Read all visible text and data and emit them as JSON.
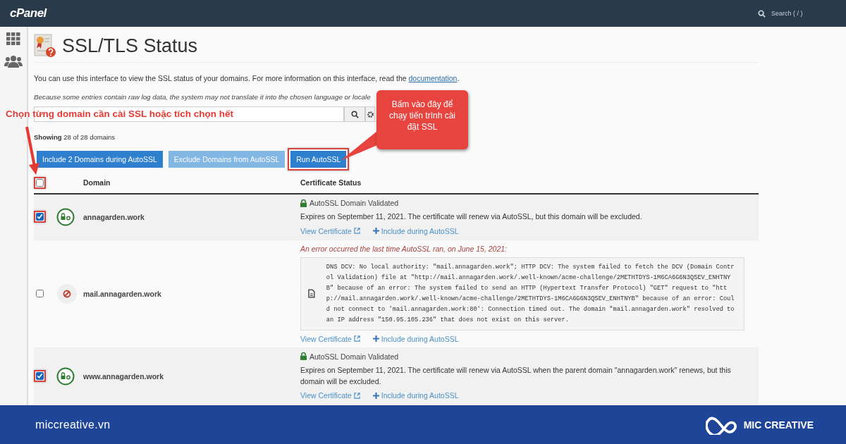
{
  "header": {
    "logo": "cPanel",
    "search_placeholder": "Search ( / )"
  },
  "page": {
    "title": "SSL/TLS Status",
    "description": "You can use this interface to view the SSL status of your domains. For more information on this interface, read the ",
    "description_link": "documentation",
    "description_end": ".",
    "notice": "Because some entries contain raw log data, the system may not translate it into the chosen language or locale",
    "showing": "**Showing** 28 of 28 domains"
  },
  "buttons": [
    {
      "label": "Include 2 Domains during AutoSSL",
      "kind": "primary",
      "highlighted": false
    },
    {
      "label": "Exclude Domains from AutoSSL",
      "kind": "light",
      "highlighted": false
    },
    {
      "label": "Run AutoSSL",
      "kind": "primary",
      "highlighted": true
    }
  ],
  "table": {
    "select_all": {
      "checked": false,
      "highlighted": true
    },
    "columns": [
      "Domain",
      "Certificate Status"
    ],
    "rows": [
      {
        "checked": true,
        "highlighted": true,
        "kind": "validated",
        "domain": "annagarden.work",
        "status_title": "AutoSSL Domain Validated",
        "message": "Expires on September 11, 2021. The certificate will renew via AutoSSL, but this domain will be excluded.",
        "view_link": "View Certificate",
        "include_link": "Include during AutoSSL"
      },
      {
        "checked": false,
        "highlighted": false,
        "kind": "error",
        "domain": "mail.annagarden.work",
        "status_title": "An error occurred the last time AutoSSL ran, on June 15, 2021:",
        "log": "DNS DCV: No local authority: \"mail.annagarden.work\"; HTTP DCV: The system failed to fetch the DCV (Domain Control Validation) file at \"http://mail.annagarden.work/.well-known/acme-challenge/2METHTDYS-1M6CA6G6N3Q5EV_ENHTNYB\" because of an error: The system failed to send an HTTP (Hypertext Transfer Protocol) \"GET\" request to \"http://mail.annagarden.work/.well-known/acme-challenge/2METHTDYS-1M6CA6G6N3Q5EV_ENHTNYB\" because of an error: Could not connect to 'mail.annagarden.work:80': Connection timed out. The domain \"mail.annagarden.work\" resolved to an IP address \"150.95.105.236\" that does not exist on this server.",
        "view_link": "View Certificate",
        "include_link": "Include during AutoSSL"
      },
      {
        "checked": true,
        "highlighted": true,
        "kind": "validated",
        "domain": "www.annagarden.work",
        "status_title": "AutoSSL Domain Validated",
        "message": "Expires on September 11, 2021. The certificate will renew via AutoSSL when the parent domain \"annagarden.work\" renews, but this domain will be excluded.",
        "view_link": "View Certificate",
        "include_link": "Include during AutoSSL"
      }
    ]
  },
  "annotations": {
    "select_hint": "Chọn từng domain cần cài SSL hoặc tích chọn hết",
    "callout": "Bấm vào đây để chạy tiến trình cài đặt SSL"
  },
  "footer": {
    "site": "miccreative.vn",
    "brand": "MIC CREATIVE"
  }
}
